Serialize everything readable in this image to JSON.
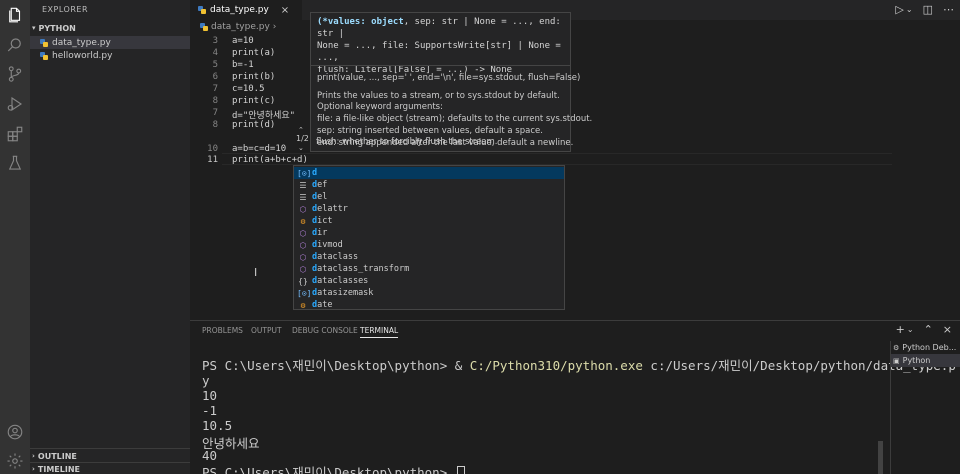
{
  "activity_icons": [
    "files-icon",
    "search-icon",
    "source-control-icon",
    "run-debug-icon",
    "extensions-icon",
    "testing-icon",
    "account-icon",
    "settings-gear-icon"
  ],
  "sidebar": {
    "title": "EXPLORER",
    "section": "PYTHON",
    "files": [
      {
        "name": "data_type.py",
        "active": true
      },
      {
        "name": "helloworld.py",
        "active": false
      }
    ],
    "outline": "OUTLINE",
    "timeline": "TIMELINE"
  },
  "tab": {
    "label": "data_type.py",
    "close": "×"
  },
  "breadcrumb": "data_type.py",
  "editor": {
    "lines": [
      {
        "num": "3",
        "code": "a=10"
      },
      {
        "num": "4",
        "code": "print(a)"
      },
      {
        "num": "5",
        "code": "b=-1"
      },
      {
        "num": "6",
        "code": "print(b)"
      },
      {
        "num": "7",
        "code": "c=10.5"
      },
      {
        "num": "8",
        "code": "print(c)"
      },
      {
        "num": "7",
        "code": "d=\"안녕하세요\""
      },
      {
        "num": "8",
        "code": "print(d)"
      },
      {
        "num": "",
        "code": ""
      },
      {
        "num": "10",
        "code": "a=b=c=d=10"
      },
      {
        "num": "11",
        "code": "print(a+b+c+d)"
      }
    ]
  },
  "hover": {
    "sig1_bold": "(*values: object",
    "sig1_rest": ", sep: str | None = ..., end: str |",
    "sig2": "None = ..., file: SupportsWrite[str] | None = ...,",
    "sig3": "flush: Literal[False] = ...) -> None",
    "doc": [
      "print(value, ..., sep=' ', end='\\n', file=sys.stdout, flush=False)",
      "Prints the values to a stream, or to sys.stdout by default.",
      "Optional keyword arguments:",
      "file: a file-like object (stream); defaults to the current sys.stdout.",
      "sep: string inserted between values, default a space.",
      "end: string appended after the last value, default a newline.",
      "flush: whether to forcibly flush the stream."
    ],
    "counter": "1/2"
  },
  "suggestions": [
    {
      "icon": "variable-icon",
      "glyph": "[⊙]",
      "color": "#75beff",
      "match": "d",
      "rest": ""
    },
    {
      "icon": "keyword-icon",
      "glyph": "☰",
      "color": "#cccccc",
      "match": "d",
      "rest": "ef"
    },
    {
      "icon": "keyword-icon",
      "glyph": "☰",
      "color": "#cccccc",
      "match": "d",
      "rest": "el"
    },
    {
      "icon": "function-icon",
      "glyph": "⬡",
      "color": "#b180d7",
      "match": "d",
      "rest": "elattr"
    },
    {
      "icon": "class-icon",
      "glyph": "⚙",
      "color": "#ee9d28",
      "match": "d",
      "rest": "ict"
    },
    {
      "icon": "function-icon",
      "glyph": "⬡",
      "color": "#b180d7",
      "match": "d",
      "rest": "ir"
    },
    {
      "icon": "function-icon",
      "glyph": "⬡",
      "color": "#b180d7",
      "match": "d",
      "rest": "ivmod"
    },
    {
      "icon": "function-icon",
      "glyph": "⬡",
      "color": "#b180d7",
      "match": "d",
      "rest": "ataclass"
    },
    {
      "icon": "function-icon",
      "glyph": "⬡",
      "color": "#b180d7",
      "match": "d",
      "rest": "ataclass_transform"
    },
    {
      "icon": "module-icon",
      "glyph": "{}",
      "color": "#cccccc",
      "match": "d",
      "rest": "ataclasses"
    },
    {
      "icon": "variable-icon",
      "glyph": "[⊙]",
      "color": "#75beff",
      "match": "d",
      "rest": "atasizemask"
    },
    {
      "icon": "class-icon",
      "glyph": "⚙",
      "color": "#ee9d28",
      "match": "d",
      "rest": "ate"
    }
  ],
  "panel": {
    "tabs": [
      "PROBLEMS",
      "OUTPUT",
      "DEBUG CONSOLE",
      "TERMINAL"
    ],
    "active_tab": "TERMINAL",
    "terminal": {
      "prompt1_a": "PS C:\\Users\\재민이\\Desktop\\python> & ",
      "prompt1_exe": "C:/Python310/python.exe",
      "prompt1_b": " c:/Users/재민이/Desktop/python/data_type.p",
      "wrap": "y",
      "outputs": [
        "10",
        "-1",
        "10.5",
        "안녕하세요",
        "40"
      ],
      "prompt2": "PS C:\\Users\\재민이\\Desktop\\python> "
    },
    "terminal_list": [
      "Python Deb...",
      "Python"
    ]
  }
}
